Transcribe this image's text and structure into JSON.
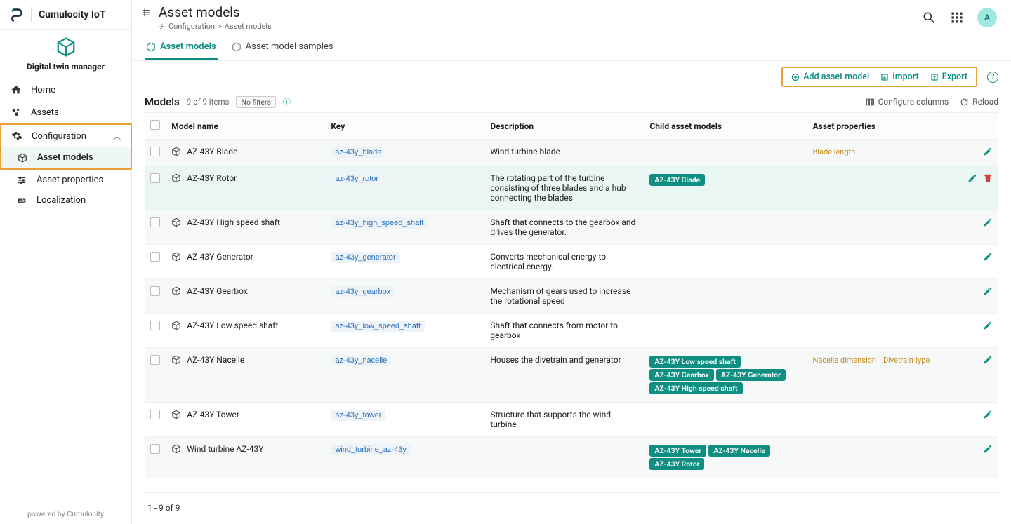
{
  "brand": {
    "name": "Cumulocity IoT"
  },
  "module": {
    "title": "Digital twin manager"
  },
  "nav": {
    "home": "Home",
    "assets": "Assets",
    "configuration": "Configuration",
    "sub": {
      "asset_models": "Asset models",
      "asset_properties": "Asset properties",
      "localization": "Localization"
    }
  },
  "footer": "powered by Cumulocity",
  "page": {
    "title": "Asset models",
    "breadcrumb_root": "Configuration",
    "breadcrumb_leaf": "Asset models"
  },
  "header_actions": {
    "avatar_letter": "A"
  },
  "tabs": {
    "models": "Asset models",
    "samples": "Asset model samples"
  },
  "toolbar": {
    "add": "Add asset model",
    "import": "Import",
    "export": "Export"
  },
  "section": {
    "title": "Models",
    "count": "9 of 9 items",
    "no_filters": "No filters",
    "configure_columns": "Configure columns",
    "reload": "Reload"
  },
  "columns": {
    "name": "Model name",
    "key": "Key",
    "desc": "Description",
    "child": "Child asset models",
    "prop": "Asset properties"
  },
  "rows": [
    {
      "name": "AZ-43Y Blade",
      "key": "az-43y_blade",
      "desc": "Wind turbine blade",
      "children": [],
      "props": [
        "Blade length"
      ]
    },
    {
      "name": "AZ-43Y Rotor",
      "key": "az-43y_rotor",
      "desc": "The rotating part of the turbine consisting of three blades and a hub connecting the blades",
      "children": [
        "AZ-43Y Blade"
      ],
      "props": [],
      "hovered": true
    },
    {
      "name": "AZ-43Y High speed shaft",
      "key": "az-43y_high_speed_shaft",
      "desc": "Shaft that connects to the gearbox and drives the generator.",
      "children": [],
      "props": []
    },
    {
      "name": "AZ-43Y Generator",
      "key": "az-43y_generator",
      "desc": "Converts mechanical energy to electrical energy.",
      "children": [],
      "props": []
    },
    {
      "name": "AZ-43Y Gearbox",
      "key": "az-43y_gearbox",
      "desc": "Mechanism of gears used to increase the rotational speed",
      "children": [],
      "props": []
    },
    {
      "name": "AZ-43Y Low speed shaft",
      "key": "az-43y_low_speed_shaft",
      "desc": "Shaft that connects from motor to gearbox",
      "children": [],
      "props": []
    },
    {
      "name": "AZ-43Y Nacelle",
      "key": "az-43y_nacelle",
      "desc": "Houses the divetrain and generator",
      "children": [
        "AZ-43Y Low speed shaft",
        "AZ-43Y Gearbox",
        "AZ-43Y Generator",
        "AZ-43Y High speed shaft"
      ],
      "props": [
        "Nacelle dimension",
        "Divetrain type"
      ]
    },
    {
      "name": "AZ-43Y Tower",
      "key": "az-43y_tower",
      "desc": "Structure that supports the wind turbine",
      "children": [],
      "props": []
    },
    {
      "name": "Wind turbine AZ-43Y",
      "key": "wind_turbine_az-43y",
      "desc": "",
      "children": [
        "AZ-43Y Tower",
        "AZ-43Y Nacelle",
        "AZ-43Y Rotor"
      ],
      "props": []
    }
  ],
  "pager": "1 - 9 of 9"
}
